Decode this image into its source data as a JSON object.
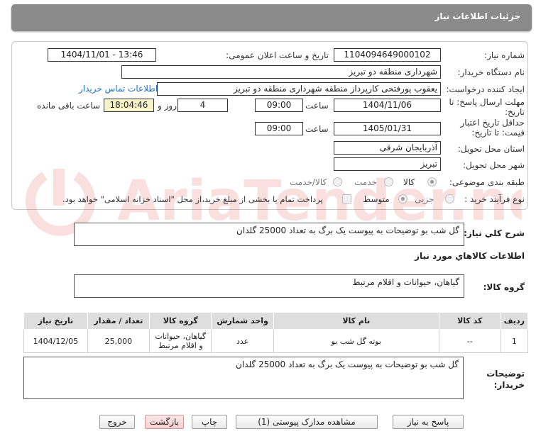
{
  "header": {
    "title": "جزئیات اطلاعات نیاز"
  },
  "form": {
    "need_number_label": "شماره نیاز:",
    "need_number": "1104094649000102",
    "announce_label": "تاریخ و ساعت اعلان عمومی:",
    "announce_value": "1404/11/01 - 13:46",
    "buyer_org_label": "نام دستگاه خریدار:",
    "buyer_org": "شهرداری منطقه دو تبریز",
    "creator_label": "ایجاد کننده درخواست:",
    "creator": "یعقوب پورفتحی کارپرداز منطقه شهرداری منطقه دو تبریز",
    "contact_link": "اطلاعات تماس خریدار",
    "deadline_label": "مهلت ارسال پاسخ: تا تاریخ:",
    "deadline_date": "1404/11/06",
    "time_label": "ساعت",
    "deadline_time": "09:00",
    "days_left": "4",
    "days_and_label": "روز و",
    "remaining_time": "18:04:46",
    "remaining_label": "ساعت باقی مانده",
    "validity_label": "حداقل تاریخ اعتبار قیمت: تا تاریخ:",
    "validity_date": "1405/01/31",
    "validity_time": "09:00",
    "province_label": "استان محل تحویل:",
    "province": "آذربایجان شرقی",
    "city_label": "شهر محل تحویل:",
    "city": "تبریز",
    "category_label": "طبقه بندی موضوعی:",
    "category_options": [
      "کالا",
      "خدمت",
      "کالا/خدمت"
    ],
    "process_label": "نوع فرآیند خرید :",
    "process_options": [
      "جزیی",
      "متوسط"
    ],
    "payment_note": "پرداخت تمام یا بخشی از مبلغ خرید،از محل \"اسناد خزانه اسلامی\" خواهد بود."
  },
  "summary": {
    "label": "شرح کلي نياز:",
    "text": "گل شب بو توضیحات به پیوست یک برگ به تعداد 25000 گلدان"
  },
  "goods_info_title": "اطلاعات کالاهاي مورد نياز",
  "goods_group": {
    "label": "گروه کالا:",
    "text": "گیاهان، حیوانات و اقلام مرتبط"
  },
  "table": {
    "headers": [
      "ردیف",
      "کد کالا",
      "نام کالا",
      "واحد شمارش",
      "گروه کالا",
      "تعداد / مقدار",
      "تاریخ نیاز"
    ],
    "rows": [
      [
        "1",
        "--",
        "بوته گل شب بو",
        "عدد",
        "گیاهان، حیوانات و اقلام مرتبط",
        "25,000",
        "1404/12/05"
      ]
    ]
  },
  "buyer_notes": {
    "label": "توضیحات خریدار:",
    "text": "گل شب بو توضیحات به پیوست یک برگ به تعداد 25000 گلدان"
  },
  "buttons": {
    "reply": "پاسخ به نیاز",
    "docs": "مشاهده مدارک پیوستی (1)",
    "print": "چاپ",
    "back": "بازگشت",
    "exit": "خروج"
  },
  "watermark": "AriaTender.neT"
}
